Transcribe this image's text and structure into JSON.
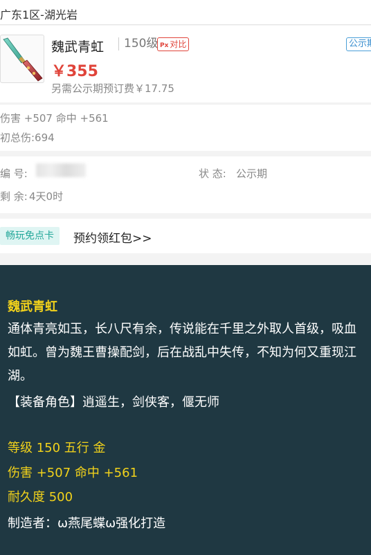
{
  "server": "广东1区-湖光岩",
  "item": {
    "name": "魏武青虹",
    "level": "150级",
    "compare_label": "对比",
    "compare_icon": "Px",
    "period_tag": "公示期",
    "price": "￥355",
    "extra_fee": "另需公示期预订费￥17.75"
  },
  "stats": {
    "line1": "伤害 +507 命中 +561",
    "line2": "初总伤:694"
  },
  "info": {
    "id_label": "编 号:",
    "status_label": "状 态:",
    "status_value": "公示期",
    "remaining_label": "剩 余:",
    "remaining_value": "4天0时"
  },
  "promo": {
    "badge": "畅玩免点卡",
    "link": "预约领红包>>"
  },
  "desc": {
    "title": "魏武青虹",
    "body": "通体青亮如玉，长八尺有余，传说能在千里之外取人首级，吸血如虹。曾为魏王曹操配剑，后在战乱中失传，不知为何又重现江湖。",
    "role": "【装备角色】逍遥生，剑侠客，偃无师",
    "level_line": "等级 150 五行 金",
    "attr_line": "伤害 +507 命中 +561",
    "durability_line": "耐久度 500",
    "maker_line": "制造者：ω燕尾蝶ω强化打造"
  },
  "colors": {
    "price_red": "#e0443a",
    "attr_yellow": "#f2d21b",
    "desc_bg": "#1f3842",
    "tag_blue": "#3b8fcf",
    "promo_teal": "#25a89a"
  },
  "icons": {
    "item_image": "sword-icon"
  }
}
